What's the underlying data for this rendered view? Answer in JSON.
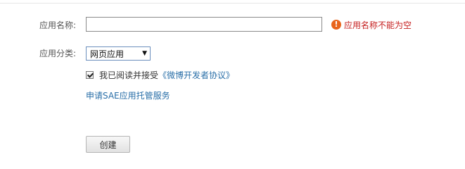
{
  "form": {
    "name_label": "应用名称:",
    "name_value": "",
    "name_error": "应用名称不能为空",
    "error_icon_glyph": "!",
    "category_label": "应用分类:",
    "category_selected": "网页应用",
    "agree_checked": true,
    "agree_text": "我已阅读并接受",
    "agree_link": "《微博开发者协议》",
    "sae_link": "申请SAE应用托管服务",
    "create_button": "创建"
  },
  "colors": {
    "error_text": "#c62020",
    "error_icon": "#e8641c",
    "link": "#2a6fa8"
  },
  "icons": {
    "error": "exclamation-circle-icon",
    "select_arrow": "triangle-down-icon",
    "checkbox": "checkmark-icon"
  }
}
